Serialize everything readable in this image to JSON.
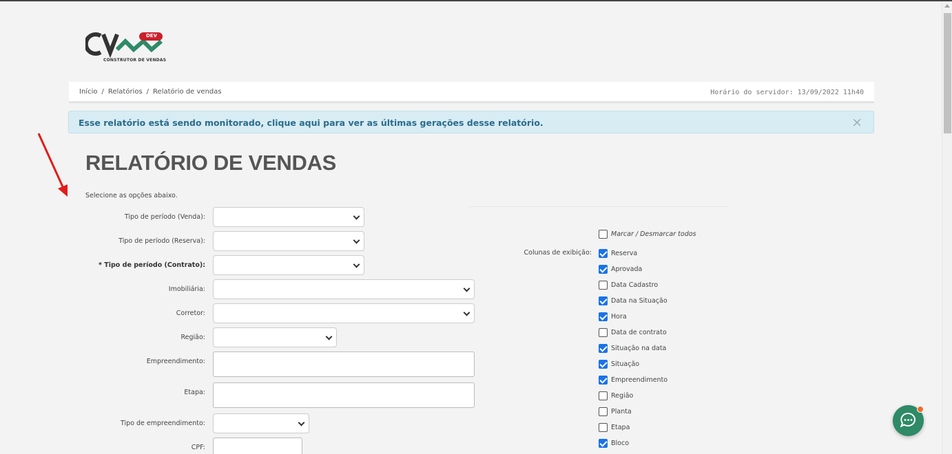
{
  "brand": {
    "tagline": "CONSTRUTOR DE VENDAS",
    "badge": "DEV",
    "colors": {
      "primary": "#2e8a67",
      "badge": "#c9202b",
      "dark": "#333333"
    }
  },
  "breadcrumb": {
    "items": [
      "Início",
      "Relatórios",
      "Relatório de vendas"
    ],
    "separator": "/"
  },
  "server_time": "Horário do servidor: 13/09/2022 11h40",
  "alert": {
    "text": "Esse relatório está sendo monitorado, clique aqui para ver as últimas gerações desse relatório.",
    "close": "×"
  },
  "page": {
    "title": "RELATÓRIO DE VENDAS",
    "subtitle": "Selecione as opções abaixo."
  },
  "form": {
    "tipo_venda": {
      "label": "Tipo de período (Venda):",
      "value": ""
    },
    "tipo_reserva": {
      "label": "Tipo de período (Reserva):",
      "value": ""
    },
    "tipo_contrato": {
      "label": "* Tipo de período (Contrato):",
      "value": ""
    },
    "imobiliaria": {
      "label": "Imobiliária:",
      "value": ""
    },
    "corretor": {
      "label": "Corretor:",
      "value": ""
    },
    "regiao": {
      "label": "Região:",
      "value": ""
    },
    "empreendimento": {
      "label": "Empreendimento:",
      "value": ""
    },
    "etapa": {
      "label": "Etapa:",
      "value": ""
    },
    "tipo_empreendimento": {
      "label": "Tipo de empreendimento:",
      "value": ""
    },
    "cpf": {
      "label": "CPF:",
      "value": ""
    }
  },
  "columns": {
    "label": "Colunas de exibição:",
    "toggle_all": {
      "label": "Marcar / Desmarcar todos",
      "checked": false
    },
    "items": [
      {
        "label": "Reserva",
        "checked": true
      },
      {
        "label": "Aprovada",
        "checked": true
      },
      {
        "label": "Data Cadastro",
        "checked": false
      },
      {
        "label": "Data na Situação",
        "checked": true
      },
      {
        "label": "Hora",
        "checked": true
      },
      {
        "label": "Data de contrato",
        "checked": false
      },
      {
        "label": "Situação na data",
        "checked": true
      },
      {
        "label": "Situação",
        "checked": true
      },
      {
        "label": "Empreendimento",
        "checked": true
      },
      {
        "label": "Região",
        "checked": false
      },
      {
        "label": "Planta",
        "checked": false
      },
      {
        "label": "Etapa",
        "checked": false
      },
      {
        "label": "Bloco",
        "checked": true
      }
    ]
  },
  "chat": {
    "icon": "chat-bubble-icon"
  }
}
